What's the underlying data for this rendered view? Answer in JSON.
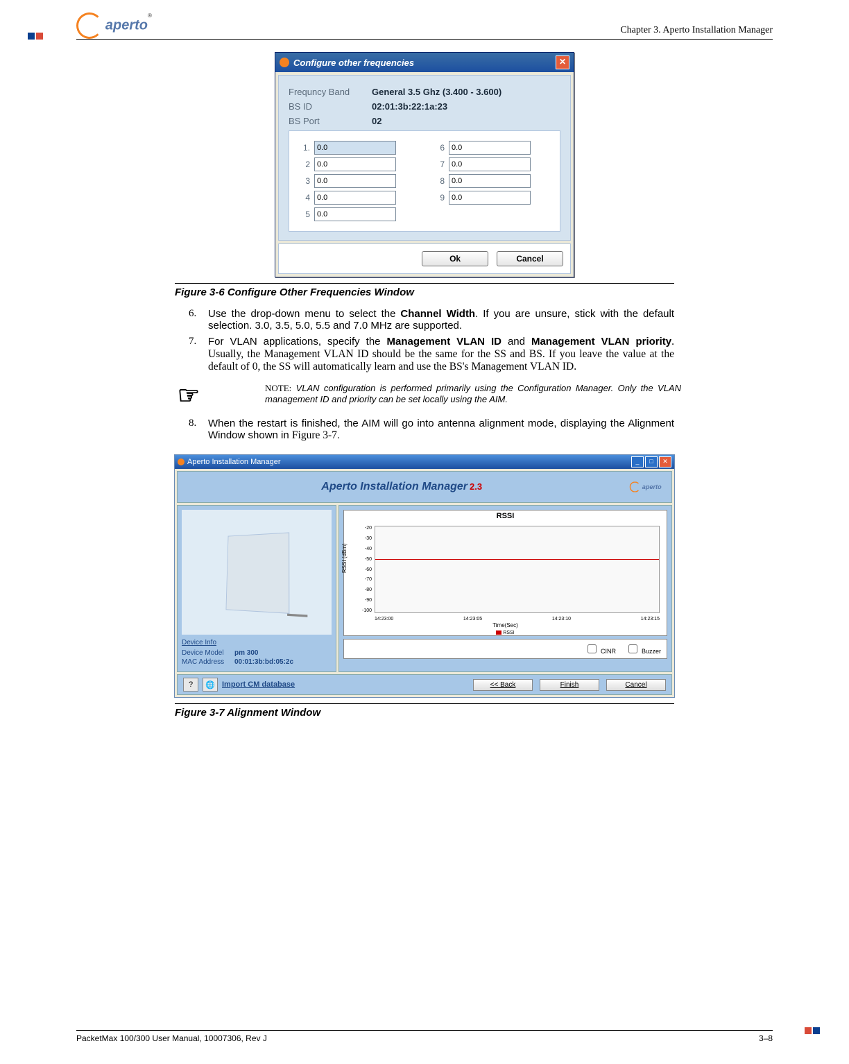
{
  "header": {
    "chapter": "Chapter 3.  Aperto Installation Manager",
    "logo_text": "aperto",
    "logo_r": "®"
  },
  "fig36": {
    "titlebar": "Configure other frequencies",
    "label_band": "Frequncy Band",
    "value_band": "General 3.5 Ghz (3.400 - 3.600)",
    "label_bsid": "BS ID",
    "value_bsid": "02:01:3b:22:1a:23",
    "label_bsport": "BS Port",
    "value_bsport": "02",
    "nums_left": [
      "1.",
      "2",
      "3",
      "4",
      "5"
    ],
    "nums_right": [
      "6",
      "7",
      "8",
      "9"
    ],
    "input_default": "0.0",
    "btn_ok": "Ok",
    "btn_cancel": "Cancel",
    "caption": "Figure 3-6        Configure Other Frequencies Window"
  },
  "steps": {
    "n6": "6.",
    "t6a": "Use the drop-down menu to select the ",
    "t6b": "Channel Width",
    "t6c": ". If you are unsure, stick with the default selection. 3.0, 3.5, 5.0, 5.5 and 7.0 MHz are supported.",
    "n7": "7.",
    "t7a": "For VLAN applications, specify the ",
    "t7b": "Management VLAN ID",
    "t7c": " and ",
    "t7d": "Management VLAN priority",
    "t7e": ". Usually, the Management VLAN ID should be the same for the SS and BS. If you leave the value at the default of 0, the SS will automatically learn and use the BS's Management VLAN ID.",
    "note_label": "NOTE:",
    "note_body": "VLAN configuration is performed primarily using the Configuration Manager. Only the VLAN management ID and priority can be set locally using the AIM.",
    "n8": "8.",
    "t8a": "When the restart is finished, the AIM will go into antenna alignment mode, displaying the Alignment Window shown in ",
    "t8b": "Figure 3-7",
    "t8c": "."
  },
  "fig37": {
    "titlebar": "Aperto Installation Manager",
    "banner": "Aperto Installation Manager",
    "banner_ver": "2.3",
    "devinfo_title": "Device Info",
    "dev_model_l": "Device Model",
    "dev_model_v": "pm 300",
    "dev_mac_l": "MAC Address",
    "dev_mac_v": "00:01:3b:bd:05:2c",
    "import_link": "Import CM database",
    "btn_back": "<< Back",
    "btn_finish": "Finish",
    "btn_cancel": "Cancel",
    "chk_cinr": "CINR",
    "chk_buzzer": "Buzzer",
    "caption": "Figure 3-7        Alignment Window"
  },
  "chart_data": {
    "type": "line",
    "title": "RSSI",
    "ylabel": "RSSI (dBm)",
    "xlabel": "Time(Sec)",
    "y_ticks": [
      "-20",
      "-30",
      "-40",
      "-50",
      "-60",
      "-70",
      "-80",
      "-90",
      "-100"
    ],
    "x_ticks": [
      "14:23:00",
      "14:23:05",
      "14:23:10",
      "14:23:15"
    ],
    "ylim": [
      -100,
      -20
    ],
    "series": [
      {
        "name": "RSSI",
        "color": "#c00",
        "approx_value": -52
      }
    ],
    "legend": "RSSI"
  },
  "footer": {
    "left": "PacketMax 100/300 User Manual, 10007306, Rev J",
    "right": "3–8"
  }
}
